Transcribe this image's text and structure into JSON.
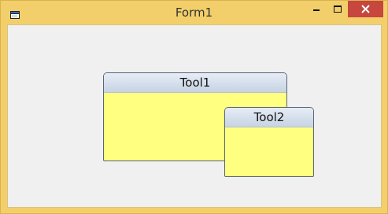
{
  "window": {
    "title": "Form1"
  },
  "titlebar": {
    "app_icon": "window-icon",
    "minimize_icon": "minimize-icon",
    "maximize_icon": "maximize-icon",
    "close_icon": "close-icon",
    "close_color": "#c7463d"
  },
  "colors": {
    "frame": "#f2cf6a",
    "client_background": "#f0f0f0",
    "tool_body": "#ffff80",
    "tool_header_top": "#e6edf6",
    "tool_header_bottom": "#c7d3e3",
    "tool_border": "#5a6478"
  },
  "tools": [
    {
      "title": "Tool1"
    },
    {
      "title": "Tool2"
    }
  ]
}
